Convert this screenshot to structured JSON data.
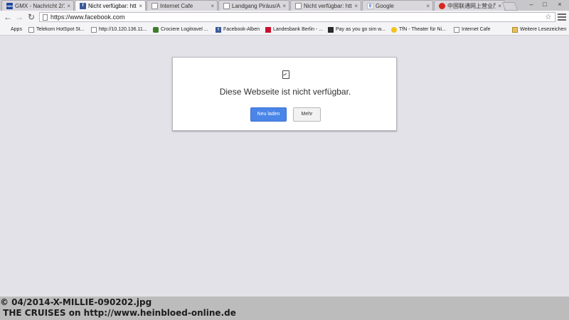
{
  "tabs": [
    {
      "label": "GMX - Nachricht 2/14",
      "favicon": "gmx-icon",
      "active": false
    },
    {
      "label": "Nicht verfügbar: https",
      "favicon": "facebook-icon",
      "active": true
    },
    {
      "label": "Internet Cafe",
      "favicon": "page-icon",
      "active": false
    },
    {
      "label": "Landgang Piräus/Athe",
      "favicon": "page-icon",
      "active": false
    },
    {
      "label": "Nicht verfügbar: https:",
      "favicon": "page-icon",
      "active": false
    },
    {
      "label": "Google",
      "favicon": "google-icon",
      "active": false
    },
    {
      "label": "中国联通网上营业厅-",
      "favicon": "china-unicom-icon",
      "active": false
    }
  ],
  "tab_close_glyph": "×",
  "window": {
    "minimize": "–",
    "maximize": "□",
    "close": "×"
  },
  "omnibox": {
    "url": "https://www.facebook.com"
  },
  "bookmarks": [
    {
      "label": "Apps",
      "icon": "apps-icon"
    },
    {
      "label": "Telekom HotSpot St...",
      "icon": "page-icon"
    },
    {
      "label": "http://10.120.136.11...",
      "icon": "page-icon"
    },
    {
      "label": "Crociere Logitravel ...",
      "icon": "logitravel-icon"
    },
    {
      "label": "Facebook-Alben",
      "icon": "facebook-icon"
    },
    {
      "label": "Landesbank Berlin - ...",
      "icon": "landesbank-icon"
    },
    {
      "label": "Pay as you go sim w...",
      "icon": "pay-as-you-go-icon"
    },
    {
      "label": "TfN - Theater für Ni...",
      "icon": "sun-icon"
    },
    {
      "label": "Internet Cafe",
      "icon": "page-icon"
    },
    {
      "label": "Weitere Lesezeichen",
      "icon": "folder-icon"
    }
  ],
  "error": {
    "title": "Diese Webseite ist nicht verfügbar.",
    "reload_label": "Neu laden",
    "more_label": "Mehr"
  },
  "caption": {
    "line1": "© 04/2014-X-MILLIE-090202.jpg",
    "line2": " THE CRUISES on http://www.heinbloed-online.de"
  },
  "colors": {
    "page_background": "#e4e2e9",
    "reload_button": "#4a85e8",
    "caption_band": "#bcbcbc"
  }
}
